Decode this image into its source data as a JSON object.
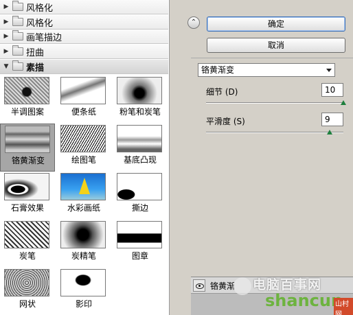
{
  "categories": [
    {
      "label": "风格化",
      "expanded": false
    },
    {
      "label": "画笔描边",
      "expanded": false
    },
    {
      "label": "扭曲",
      "expanded": false
    },
    {
      "label": "素描",
      "expanded": true
    }
  ],
  "thumbnails": [
    {
      "label": "半调图案",
      "selected": false
    },
    {
      "label": "便条纸",
      "selected": false
    },
    {
      "label": "粉笔和炭笔",
      "selected": false
    },
    {
      "label": "铬黄渐变",
      "selected": true
    },
    {
      "label": "绘图笔",
      "selected": false
    },
    {
      "label": "基底凸现",
      "selected": false
    },
    {
      "label": "石膏效果",
      "selected": false
    },
    {
      "label": "水彩画纸",
      "selected": false
    },
    {
      "label": "撕边",
      "selected": false
    },
    {
      "label": "炭笔",
      "selected": false
    },
    {
      "label": "炭精笔",
      "selected": false
    },
    {
      "label": "图章",
      "selected": false
    },
    {
      "label": "网状",
      "selected": false
    },
    {
      "label": "影印",
      "selected": false
    }
  ],
  "buttons": {
    "ok": "确定",
    "cancel": "取消"
  },
  "filter_select": {
    "value": "铬黄渐变"
  },
  "params": [
    {
      "label": "细节 (D)",
      "value": "10",
      "fraction": 1.0
    },
    {
      "label": "平滑度 (S)",
      "value": "9",
      "fraction": 0.9
    }
  ],
  "layer": {
    "name": "铬黄渐"
  },
  "watermark": {
    "line1": "电脑百事网",
    "line2": "shancun",
    "badge": "山村网"
  },
  "colors": {
    "slider_thumb": "#1d7f3d",
    "watermark_green": "#6db33f",
    "selection": "#a6a6a6"
  }
}
